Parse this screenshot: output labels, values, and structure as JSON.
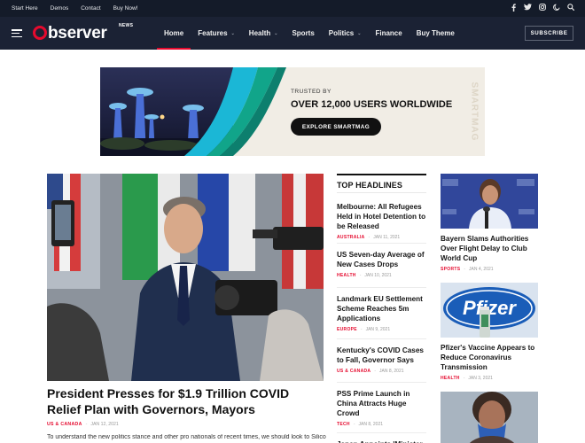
{
  "topbar": {
    "links": [
      "Start Here",
      "Demos",
      "Contact",
      "Buy Now!"
    ],
    "icons": [
      "facebook-icon",
      "twitter-icon",
      "instagram-icon",
      "dark-mode-icon",
      "search-icon"
    ]
  },
  "logo": {
    "text": "Observer",
    "tag": "NEWS"
  },
  "nav": {
    "items": [
      {
        "label": "Home",
        "dropdown": false,
        "active": true
      },
      {
        "label": "Features",
        "dropdown": true,
        "active": false
      },
      {
        "label": "Health",
        "dropdown": true,
        "active": false
      },
      {
        "label": "Sports",
        "dropdown": false,
        "active": false
      },
      {
        "label": "Politics",
        "dropdown": true,
        "active": false
      },
      {
        "label": "Finance",
        "dropdown": false,
        "active": false
      },
      {
        "label": "Buy Theme",
        "dropdown": false,
        "active": false
      }
    ],
    "subscribe": "SUBSCRIBE"
  },
  "ad": {
    "trusted": "TRUSTED BY",
    "headline": "OVER 12,000 USERS WORLDWIDE",
    "cta": "EXPLORE SMARTMAG",
    "vertical": "SMARTMAG"
  },
  "hero": {
    "title": "President Presses for $1.9 Trillion COVID Relief Plan with Governors, Mayors",
    "category": "US & CANADA",
    "date": "JAN 12, 2021",
    "excerpt": "To understand the new politics stance and other pro nationals of recent times, we should look to Silicon"
  },
  "headlines": {
    "heading": "TOP HEADLINES",
    "items": [
      {
        "title": "Melbourne: All Refugees Held in Hotel Detention to be Released",
        "category": "AUSTRALIA",
        "date": "JAN 11, 2021"
      },
      {
        "title": "US Seven-day Average of New Cases Drops",
        "category": "HEALTH",
        "date": "JAN 10, 2021"
      },
      {
        "title": "Landmark EU Settlement Scheme Reaches 5m Applications",
        "category": "EUROPE",
        "date": "JAN 9, 2021"
      },
      {
        "title": "Kentucky's COVID Cases to Fall, Governor Says",
        "category": "US & CANADA",
        "date": "JAN 8, 2021"
      },
      {
        "title": "PSS Prime Launch in China Attracts Huge Crowd",
        "category": "TECH",
        "date": "JAN 8, 2021"
      },
      {
        "title": "Japan Appoints 'Minister of"
      }
    ]
  },
  "side": {
    "items": [
      {
        "title": "Bayern Slams Authorities Over Flight Delay to Club World Cup",
        "category": "SPORTS",
        "date": "JAN 4, 2021"
      },
      {
        "title": "Pfizer's Vaccine Appears to Reduce Coronavirus Transmission",
        "category": "HEALTH",
        "date": "JAN 3, 2021",
        "image_text": "Pfizer"
      },
      {
        "title": "",
        "category": "",
        "date": ""
      }
    ]
  },
  "colors": {
    "accent": "#e50a2e",
    "topbar": "#141b29",
    "nav": "#1b2234"
  }
}
